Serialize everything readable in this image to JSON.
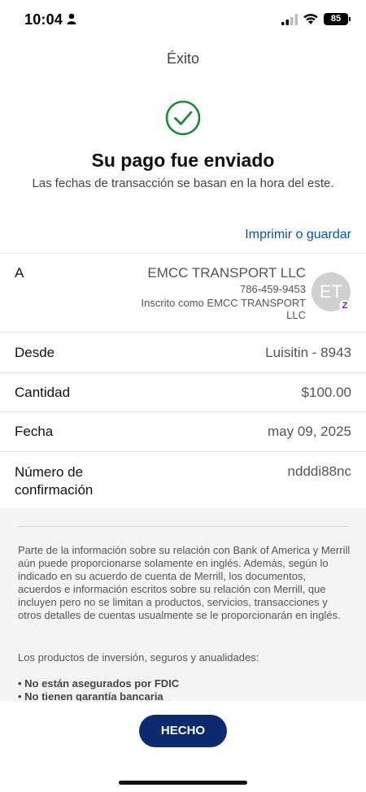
{
  "status_bar": {
    "time": "10:04",
    "battery": "85",
    "icons": [
      "person-icon",
      "signal-icon",
      "wifi-icon",
      "battery-icon"
    ]
  },
  "header": {
    "title": "Éxito"
  },
  "confirmation": {
    "icon": "checkmark-circle-icon",
    "headline": "Su pago fue enviado",
    "subline": "Las fechas de transacción se basan en la hora del este."
  },
  "print_link": "Imprimir o guardar",
  "details": {
    "recipient": {
      "label": "A",
      "name": "EMCC TRANSPORT LLC",
      "phone": "786-459-9453",
      "enrolled_as": "Inscrito como EMCC TRANSPORT LLC",
      "avatar_initials": "ET",
      "badge": "Z"
    },
    "from": {
      "label": "Desde",
      "value": "Luisitin - 8943"
    },
    "amount": {
      "label": "Cantidad",
      "value": "$100.00"
    },
    "date": {
      "label": "Fecha",
      "value": "may 09, 2025"
    },
    "confirmation_number": {
      "label": "Número de confirmación",
      "value": "ndddi88nc"
    }
  },
  "disclaimer": {
    "paragraph1": "Parte de la información sobre su relación con Bank of America y Merrill aún puede proporcionarse solamente en inglés. Además, según lo indicado en su acuerdo de cuenta de Merrill, los documentos, acuerdos e información escritos sobre su relación con Merrill, que incluyen pero no se limitan a productos, servicios, transacciones y otros detalles de cuentas usualmente se le proporcionarán en inglés.",
    "paragraph2": "Los productos de inversión, seguros y anualidades:",
    "bullets": [
      "• No están asegurados por FDIC",
      "• No tienen garantía bancaria"
    ]
  },
  "done_button": "HECHO",
  "colors": {
    "accent_link": "#0a52a5",
    "button_bg": "#0b2a6f",
    "success_green": "#1a8a3a",
    "zelle_purple": "#6d1ed4"
  }
}
